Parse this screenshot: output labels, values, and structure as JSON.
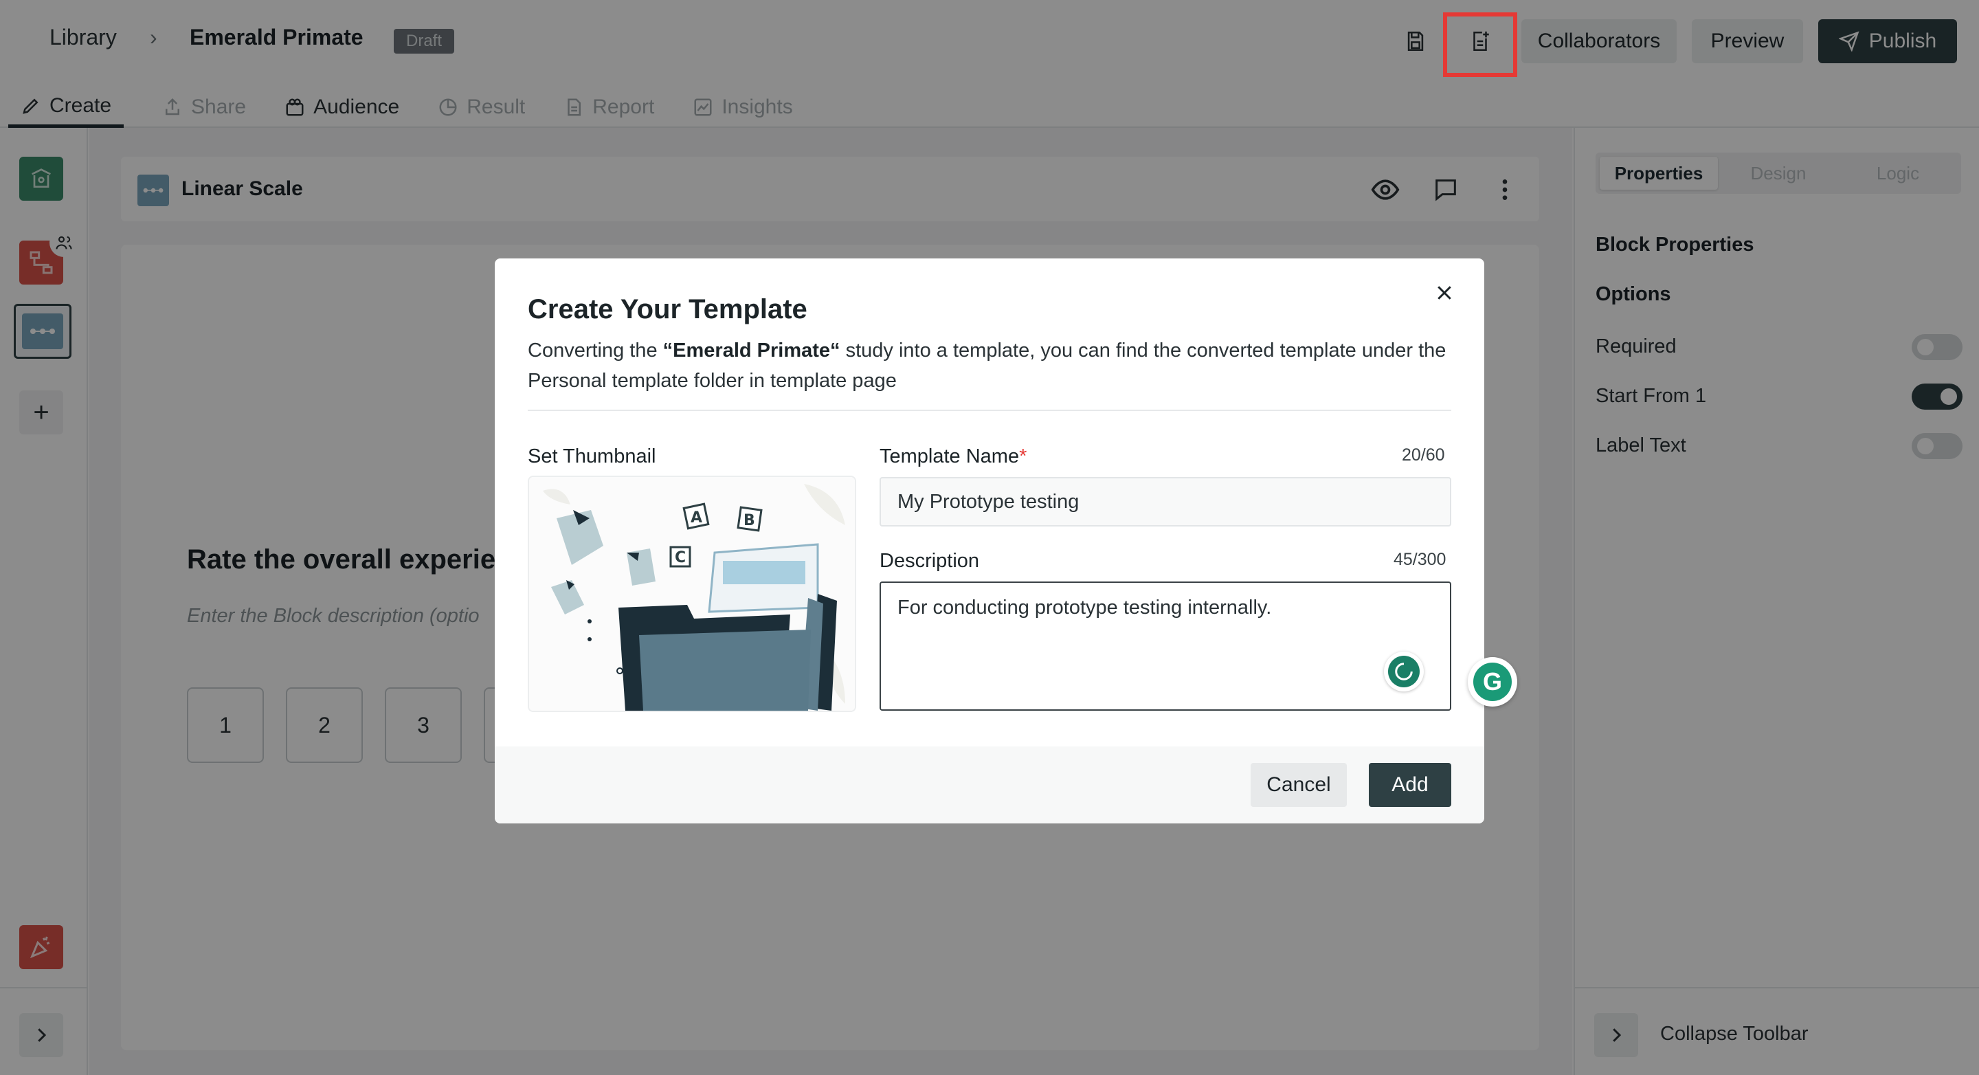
{
  "breadcrumb": {
    "library": "Library",
    "separator": "›",
    "study": "Emerald Primate",
    "status": "Draft"
  },
  "header_actions": {
    "collaborators": "Collaborators",
    "preview": "Preview",
    "publish": "Publish"
  },
  "tabs": [
    {
      "label": "Create",
      "icon": "pencil-icon",
      "state": "active"
    },
    {
      "label": "Share",
      "icon": "share-icon",
      "state": "disabled"
    },
    {
      "label": "Audience",
      "icon": "audience-icon",
      "state": "enabled"
    },
    {
      "label": "Result",
      "icon": "pie-chart-icon",
      "state": "disabled"
    },
    {
      "label": "Report",
      "icon": "report-icon",
      "state": "disabled"
    },
    {
      "label": "Insights",
      "icon": "trend-chart-icon",
      "state": "disabled"
    }
  ],
  "block": {
    "type_label": "Linear Scale",
    "question": "Rate the overall experie",
    "description_placeholder": "Enter the Block description (optio",
    "scale": [
      "1",
      "2",
      "3"
    ]
  },
  "right_panel": {
    "tabs": [
      "Properties",
      "Design",
      "Logic"
    ],
    "active_tab": "Properties",
    "section_title": "Block Properties",
    "options_title": "Options",
    "toggles": [
      {
        "label": "Required",
        "on": false
      },
      {
        "label": "Start From 1",
        "on": true
      },
      {
        "label": "Label Text",
        "on": false
      }
    ],
    "collapse_label": "Collapse Toolbar"
  },
  "modal": {
    "title": "Create Your Template",
    "desc_prefix": "Converting the ",
    "desc_study": "“Emerald Primate“",
    "desc_suffix": " study into a template, you can find the converted template under the Personal template folder in template page",
    "thumbnail_label": "Set Thumbnail",
    "name_label": "Template Name",
    "name_required": "*",
    "name_counter": "20/60",
    "name_value": "My Prototype testing",
    "desc_label": "Description",
    "desc_counter": "45/300",
    "desc_value": "For conducting prototype testing internally.",
    "cancel": "Cancel",
    "add": "Add"
  },
  "thumbnail_letters": [
    "A",
    "B",
    "C"
  ],
  "colors": {
    "primary": "#2e4044",
    "highlight": "#e53935",
    "overlay": "rgba(0,0,0,0.45)",
    "grammarly": "#1a9a77"
  },
  "grammarly_letter": "G"
}
